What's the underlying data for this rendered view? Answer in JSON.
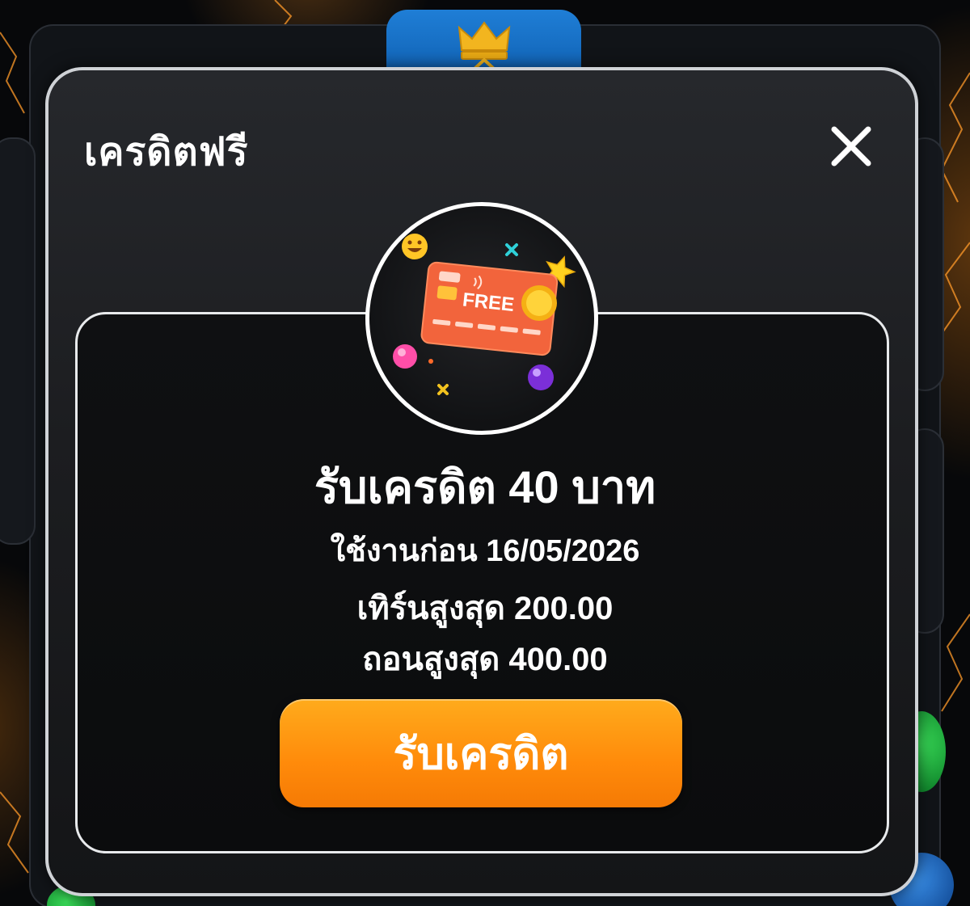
{
  "modal": {
    "title": "เครดิตฟรี",
    "close_icon": "close-icon"
  },
  "promo": {
    "card_label": "FREE",
    "reward_title": "รับเครดิต 40 บาท",
    "expiry": "ใช้งานก่อน 16/05/2026",
    "max_turnover": "เทิร์นสูงสุด 200.00",
    "max_withdraw": "ถอนสูงสุด 400.00",
    "claim_label": "รับเครดิต"
  },
  "colors": {
    "accent": "#ff8a0a",
    "card": "#f2643c",
    "tab": "#1f7ed6"
  },
  "icons": [
    "crown-icon",
    "close-icon",
    "free-credit-card-icon",
    "smile-emoji-icon",
    "star-icon",
    "coin-icon"
  ]
}
